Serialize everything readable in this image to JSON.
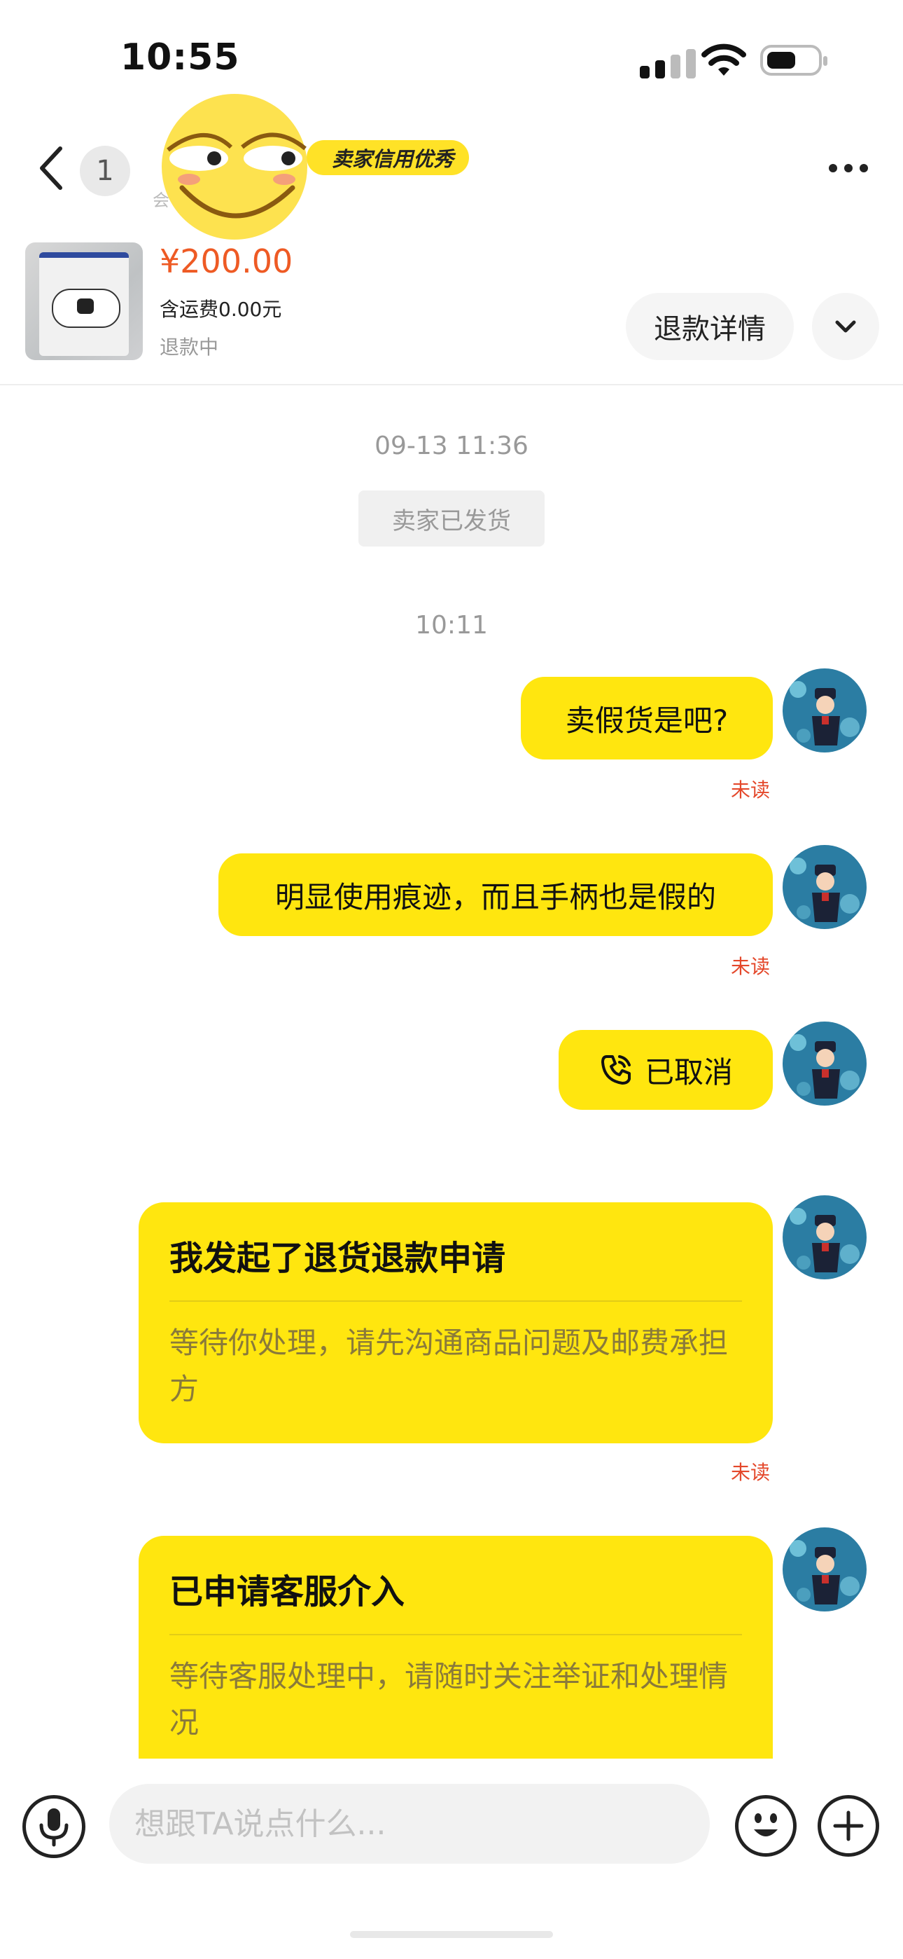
{
  "status_bar": {
    "time": "10:55"
  },
  "header": {
    "unread_count": "1",
    "credit_badge": "卖家信用优秀",
    "seller_subtitle": "会"
  },
  "order": {
    "price": "¥200.00",
    "shipping": "含运费0.00元",
    "status": "退款中",
    "refund_button": "退款详情"
  },
  "chat": {
    "timestamp_1": "09-13 11:36",
    "system_notice": "卖家已发货",
    "timestamp_2": "10:11",
    "messages": [
      {
        "text": "卖假货是吧?",
        "status": "未读"
      },
      {
        "text": "明显使用痕迹，而且手柄也是假的",
        "status": "未读"
      },
      {
        "text": "已取消"
      }
    ],
    "cards": [
      {
        "title": "我发起了退货退款申请",
        "desc": "等待你处理，请先沟通商品问题及邮费承担方",
        "status": "未读"
      },
      {
        "title": "已申请客服介入",
        "desc": "等待客服处理中，请随时关注举证和处理情况"
      }
    ]
  },
  "input": {
    "placeholder": "想跟TA说点什么..."
  },
  "colors": {
    "accent": "#ffe60f",
    "price": "#ee5a24",
    "unread": "#e4482b"
  }
}
